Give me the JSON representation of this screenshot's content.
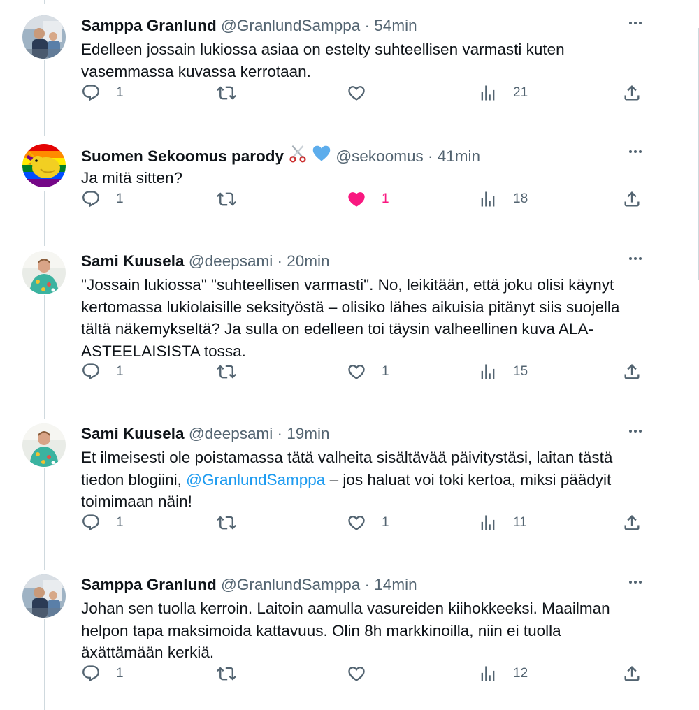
{
  "tweets": [
    {
      "name": "Samppa Granlund",
      "handle": "@GranlundSamppa",
      "time": "54min",
      "text_parts": [
        {
          "text": "Edelleen jossain lukiossa asiaa on estelty suhteellisen varmasti kuten vasemmassa kuvassa kerrotaan.",
          "mention": false
        }
      ],
      "emojis": [],
      "avatar": "profile-photo-samppa",
      "replies": "1",
      "retweets": "",
      "likes": "",
      "liked": false,
      "views": "21"
    },
    {
      "name": "Suomen Sekoomus parody",
      "handle": "@sekoomus",
      "time": "41min",
      "text_parts": [
        {
          "text": "Ja mitä sitten?",
          "mention": false
        }
      ],
      "emojis": [
        "scissors-emoji",
        "blue-heart-emoji"
      ],
      "avatar": "rainbow-bird-logo",
      "replies": "1",
      "retweets": "",
      "likes": "1",
      "liked": true,
      "views": "18"
    },
    {
      "name": "Sami Kuusela",
      "handle": "@deepsami",
      "time": "20min",
      "text_parts": [
        {
          "text": "\"Jossain lukiossa\" \"suhteellisen varmasti\". No, leikitään, että joku olisi käynyt kertomassa lukiolaisille seksityöstä – olisiko lähes aikuisia pitänyt siis suojella tältä näkemykseltä? Ja sulla on edelleen toi täysin valheellinen kuva ALA-ASTEELAISISTA tossa.",
          "mention": false
        }
      ],
      "emojis": [],
      "avatar": "profile-photo-sami",
      "replies": "1",
      "retweets": "",
      "likes": "1",
      "liked": false,
      "views": "15"
    },
    {
      "name": "Sami Kuusela",
      "handle": "@deepsami",
      "time": "19min",
      "text_parts": [
        {
          "text": "Et ilmeisesti ole poistamassa tätä valheita sisältävää päivitystäsi, laitan tästä tiedon blogiini, ",
          "mention": false
        },
        {
          "text": "@GranlundSamppa",
          "mention": true
        },
        {
          "text": " – jos haluat voi toki kertoa, miksi päädyit toimimaan näin!",
          "mention": false
        }
      ],
      "emojis": [],
      "avatar": "profile-photo-sami",
      "replies": "1",
      "retweets": "",
      "likes": "1",
      "liked": false,
      "views": "11"
    },
    {
      "name": "Samppa Granlund",
      "handle": "@GranlundSamppa",
      "time": "14min",
      "text_parts": [
        {
          "text": "Johan sen tuolla kerroin. Laitoin aamulla vasureiden kiihokkeeksi. Maailman helpon tapa maksimoida kattavuus. Olin 8h markkinoilla, niin ei tuolla äxättämään kerkiä.",
          "mention": false
        }
      ],
      "emojis": [],
      "avatar": "profile-photo-samppa",
      "replies": "1",
      "retweets": "",
      "likes": "",
      "liked": false,
      "views": "12"
    }
  ],
  "meta_separator": "·",
  "colors": {
    "text": "#0f1419",
    "secondary": "#536471",
    "link": "#1d9bf0",
    "like_active": "#f91880",
    "thread_line": "#cfd9de"
  }
}
